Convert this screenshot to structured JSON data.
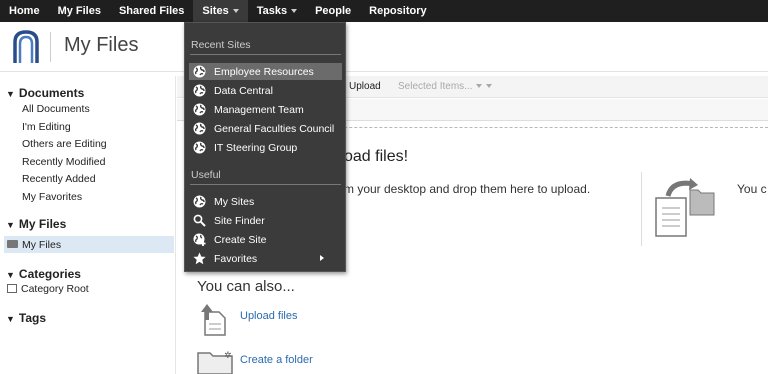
{
  "topnav": {
    "items": [
      "Home",
      "My Files",
      "Shared Files",
      "Sites",
      "Tasks",
      "People",
      "Repository"
    ]
  },
  "header": {
    "title": "My Files"
  },
  "sidebar": {
    "documents": {
      "heading": "Documents",
      "items": [
        "All Documents",
        "I'm Editing",
        "Others are Editing",
        "Recently Modified",
        "Recently Added",
        "My Favorites"
      ]
    },
    "myfiles": {
      "heading": "My Files",
      "items": [
        "My Files"
      ]
    },
    "categories": {
      "heading": "Categories",
      "items": [
        "Category Root"
      ]
    },
    "tags": {
      "heading": "Tags"
    }
  },
  "toolbar": {
    "upload_label": "Upload",
    "selected_label": "Selected Items..."
  },
  "droparea": {
    "title": "oad files!",
    "text": "m your desktop and drop them here to upload.",
    "right_text": "You c"
  },
  "also": {
    "title": "You can also...",
    "upload_label": "Upload files",
    "folder_label": "Create a folder"
  },
  "dropdown": {
    "recent_heading": "Recent Sites",
    "recent_items": [
      "Employee Resources",
      "Data Central",
      "Management Team",
      "General Faculties Council",
      "IT Steering Group"
    ],
    "useful_heading": "Useful",
    "useful_items": [
      "My Sites",
      "Site Finder",
      "Create Site",
      "Favorites"
    ]
  },
  "colors": {
    "nav_bg": "#1f1f1f",
    "dropdown_bg": "#3b3b3b",
    "link": "#2a6bb0",
    "selected_bg": "#dce9f5"
  }
}
